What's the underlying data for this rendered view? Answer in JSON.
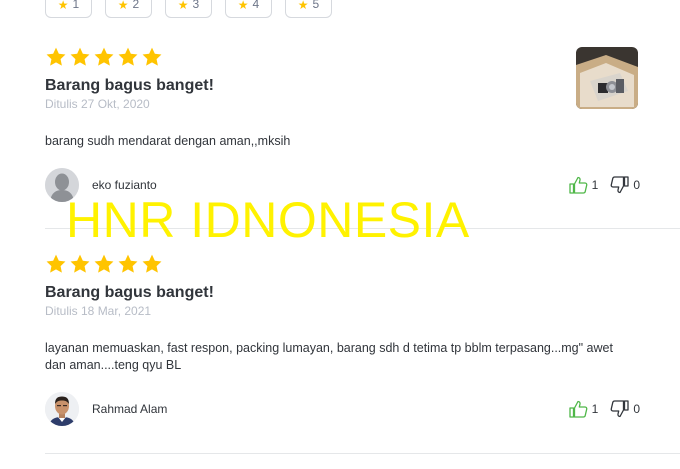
{
  "filters": [
    {
      "label": "1"
    },
    {
      "label": "2"
    },
    {
      "label": "3"
    },
    {
      "label": "4"
    },
    {
      "label": "5"
    }
  ],
  "reviews": [
    {
      "rating": 5,
      "title": "Barang bagus banget!",
      "date": "Ditulis 27 Okt, 2020",
      "text": "barang sudh mendarat dengan aman,,mksih",
      "user": "eko fuzianto",
      "likes": "1",
      "dislikes": "0",
      "has_photo": true
    },
    {
      "rating": 5,
      "title": "Barang bagus banget!",
      "date": "Ditulis 18 Mar, 2021",
      "text": "layanan memuaskan, fast respon, packing lumayan, barang sdh d tetima tp bblm terpasang...mg\" awet dan aman....teng qyu BL",
      "user": "Rahmad Alam",
      "likes": "1",
      "dislikes": "0",
      "has_photo": false
    }
  ],
  "watermark": "HNR IDNONESIA",
  "colors": {
    "star": "#ffc400",
    "like_icon": "#4fb748",
    "watermark": "#fff200",
    "date": "#b7bcc6"
  }
}
